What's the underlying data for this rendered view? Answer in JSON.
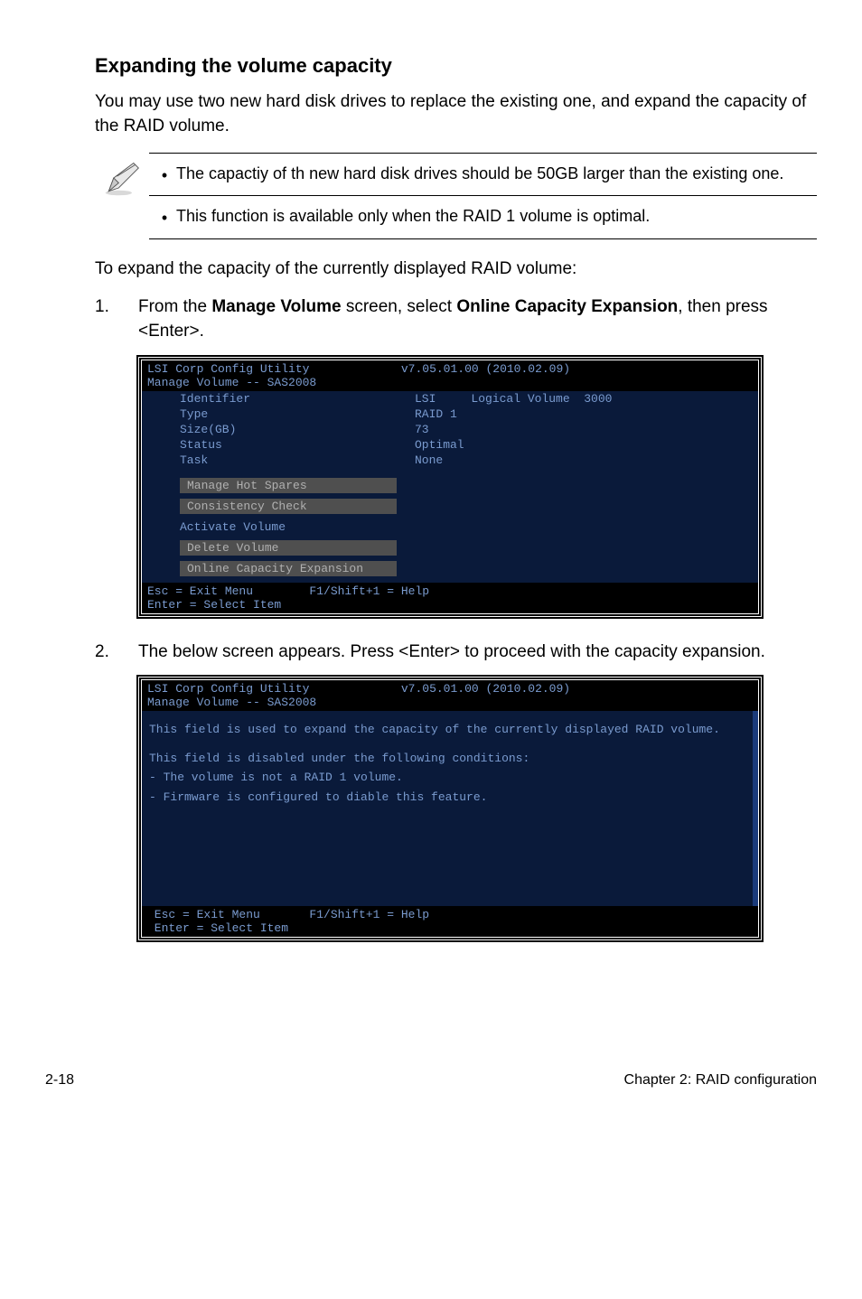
{
  "heading": "Expanding the volume capacity",
  "intro": "You may use two new hard disk drives to replace the existing one, and expand the capacity of the RAID volume.",
  "notes": {
    "n1": "The capactiy of th new hard disk drives should be 50GB larger than the existing one.",
    "n2": "This function is available only when the RAID 1 volume is optimal."
  },
  "lead": "To expand the capacity of the currently displayed RAID volume:",
  "steps": {
    "s1_pre": "From the ",
    "s1_b1": "Manage Volume",
    "s1_mid": " screen, select ",
    "s1_b2": "Online Capacity Expansion",
    "s1_post": ", then press <Enter>.",
    "s2": "The below screen appears. Press <Enter> to proceed with the capacity expansion."
  },
  "term1": {
    "title_left": "LSI Corp Config Utility",
    "title_right": "v7.05.01.00 (2010.02.09)",
    "subtitle": "Manage Volume -- SAS2008",
    "rows": {
      "identifier_k": "Identifier",
      "identifier_v": "LSI     Logical Volume  3000",
      "type_k": "Type",
      "type_v": "RAID 1",
      "size_k": "Size(GB)",
      "size_v": "73",
      "status_k": "Status",
      "status_v": "Optimal",
      "task_k": "Task",
      "task_v": "None"
    },
    "menu": {
      "m1": "Manage Hot Spares",
      "m2": "Consistency Check",
      "m3": "Activate Volume",
      "m4": "Delete Volume",
      "m5": "Online Capacity Expansion"
    },
    "footer1": "Esc = Exit Menu        F1/Shift+1 = Help",
    "footer2": "Enter = Select Item"
  },
  "term2": {
    "title_left": "LSI Corp Config Utility",
    "title_right": "v7.05.01.00 (2010.02.09)",
    "subtitle": "Manage Volume -- SAS2008",
    "p1": "This field is used to expand the capacity of the currently displayed RAID volume.",
    "p2": "This field is disabled under the following conditions:",
    "p3": "- The volume is not a RAID 1 volume.",
    "p4": "- Firmware is configured to diable this feature.",
    "footer1": " Esc = Exit Menu       F1/Shift+1 = Help",
    "footer2": " Enter = Select Item"
  },
  "footer": {
    "left": "2-18",
    "right": "Chapter 2: RAID configuration"
  }
}
